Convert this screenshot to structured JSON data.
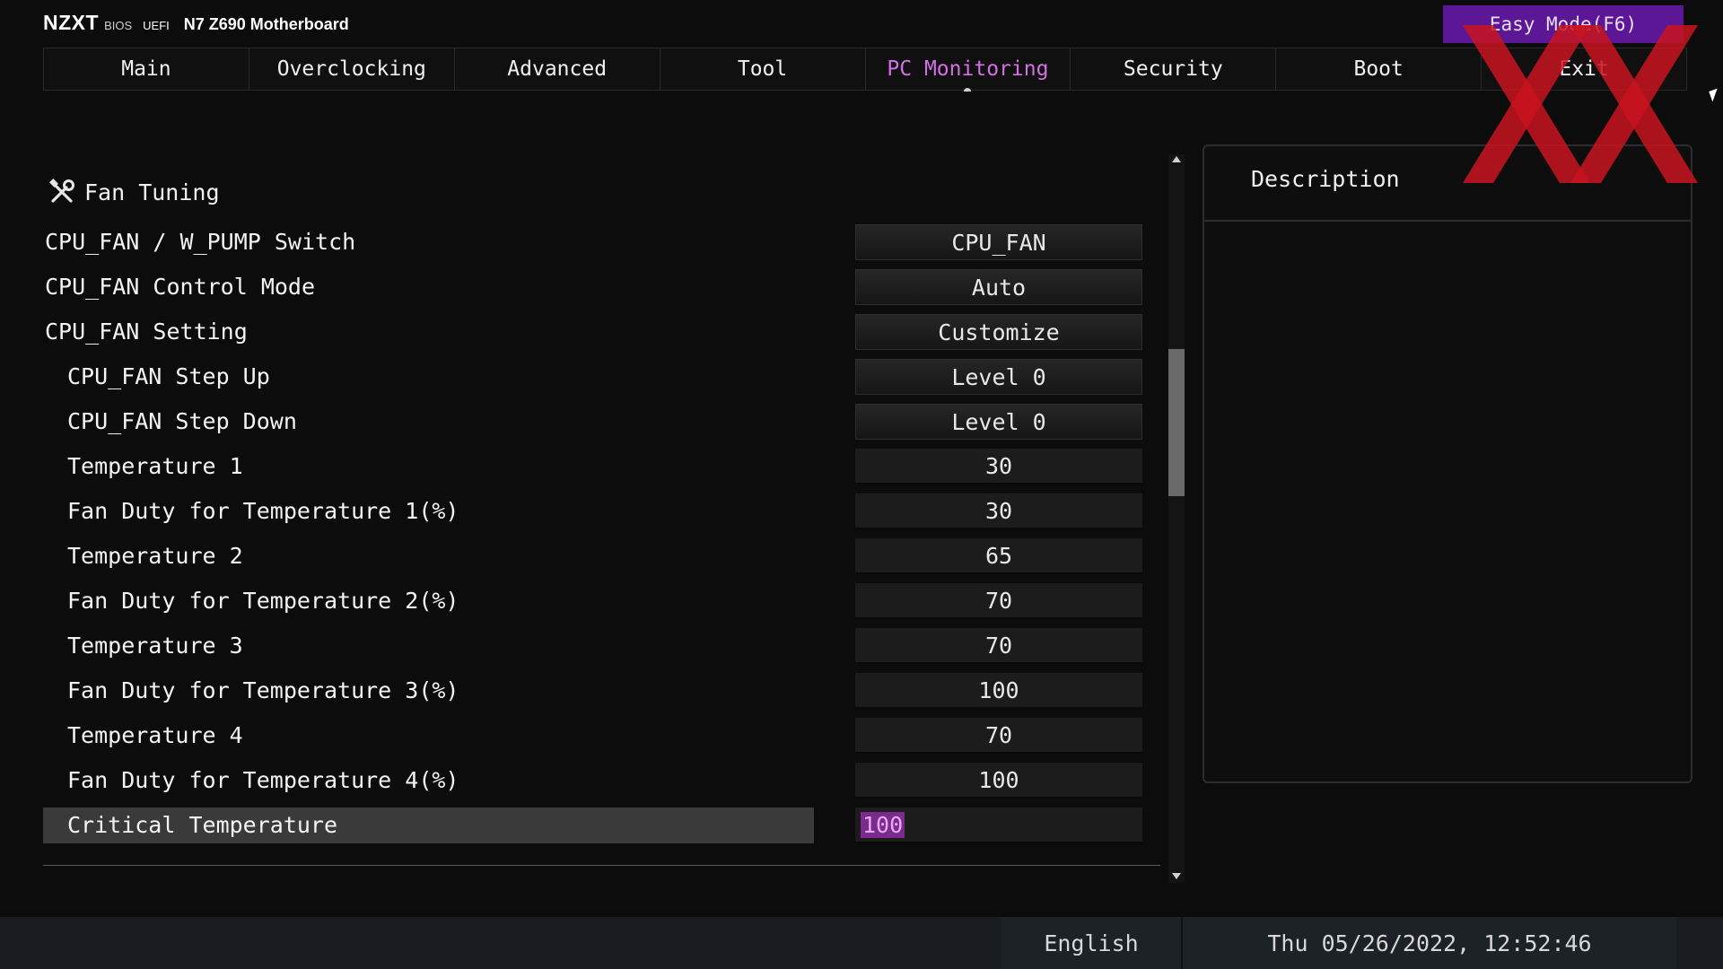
{
  "header": {
    "brand": "NZXT",
    "bios": "BIOS",
    "uefi": "UEFI",
    "board": "N7 Z690 Motherboard",
    "easy_mode": "Easy Mode(F6)"
  },
  "tabs": [
    {
      "label": "Main"
    },
    {
      "label": "Overclocking"
    },
    {
      "label": "Advanced"
    },
    {
      "label": "Tool"
    },
    {
      "label": "PC Monitoring",
      "active": true
    },
    {
      "label": "Security"
    },
    {
      "label": "Boot"
    },
    {
      "label": "Exit"
    }
  ],
  "section": {
    "title": "Fan Tuning",
    "icon": "tools-icon"
  },
  "settings": [
    {
      "label": "CPU_FAN / W_PUMP Switch",
      "value": "CPU_FAN"
    },
    {
      "label": "CPU_FAN Control Mode",
      "value": "Auto"
    },
    {
      "label": "CPU_FAN Setting",
      "value": "Customize"
    },
    {
      "label": "CPU_FAN Step Up",
      "value": "Level 0"
    },
    {
      "label": "CPU_FAN Step Down",
      "value": "Level 0"
    },
    {
      "label": "Temperature 1",
      "value": "30"
    },
    {
      "label": "Fan Duty for Temperature 1(%)",
      "value": "30"
    },
    {
      "label": "Temperature 2",
      "value": "65"
    },
    {
      "label": "Fan Duty for Temperature 2(%)",
      "value": "70"
    },
    {
      "label": "Temperature 3",
      "value": "70"
    },
    {
      "label": "Fan Duty for Temperature 3(%)",
      "value": "100"
    },
    {
      "label": "Temperature 4",
      "value": "70"
    },
    {
      "label": "Fan Duty for Temperature 4(%)",
      "value": "100"
    },
    {
      "label": "Critical Temperature",
      "value": "100"
    }
  ],
  "description": {
    "title": "Description"
  },
  "status": {
    "language": "English",
    "datetime": "Thu 05/26/2022, 12:52:46"
  },
  "colors": {
    "accent_purple": "#d46fe6",
    "easy_mode_bg": "#5c1796",
    "watermark_red": "#c8141e"
  }
}
